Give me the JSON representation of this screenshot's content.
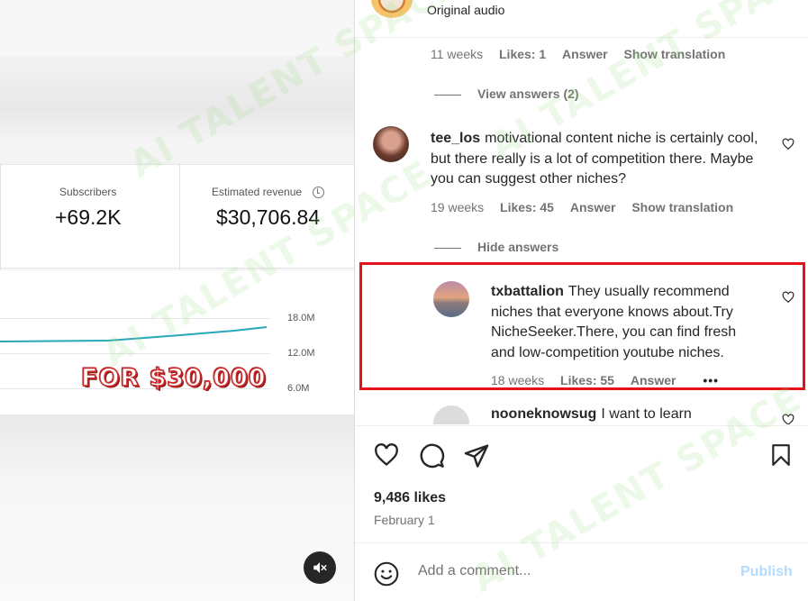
{
  "media": {
    "stats": [
      {
        "label": "Subscribers",
        "value": "+69.2K"
      },
      {
        "label": "Estimated revenue",
        "value": "$30,706.84"
      }
    ],
    "axis_ticks": [
      "18.0M",
      "12.0M",
      "6.0M"
    ],
    "overlay_text": "FOR $30,000",
    "accent_line_color": "#27a8b8",
    "overlay_color": "#c62828",
    "mute_icon": "speaker-muted-icon"
  },
  "header": {
    "audio_label": "Original audio"
  },
  "comments": {
    "prev_meta": {
      "age": "11 weeks",
      "likes": "Likes: 1",
      "reply": "Answer",
      "translate": "Show translation"
    },
    "view_answers": "View answers (2)",
    "c1": {
      "user": "tee_los",
      "text": "motivational content niche is certainly cool, but there really is a lot of competition there. Maybe you can suggest other niches?",
      "age": "19 weeks",
      "likes": "Likes: 45",
      "reply": "Answer",
      "translate": "Show translation"
    },
    "hide_answers": "Hide answers",
    "reply1": {
      "user": "txbattalion",
      "text": "They usually recommend niches that everyone knows about.Try NicheSeeker.There, you can find fresh and low-competition youtube niches.",
      "age": "18 weeks",
      "likes": "Likes: 55",
      "reply": "Answer",
      "more": "•••"
    },
    "c2": {
      "user": "nooneknowsug",
      "text": "I want to learn"
    },
    "highlight_color": "#e3121b"
  },
  "actions": {
    "icons": [
      "heart-icon",
      "comment-icon",
      "share-icon",
      "bookmark-icon"
    ]
  },
  "post": {
    "likes": "9,486 likes",
    "date": "February 1"
  },
  "composer": {
    "emoji_icon": "emoji-icon",
    "placeholder": "Add a comment...",
    "publish": "Publish",
    "publish_color": "#b3dbff"
  },
  "watermark": "AI TALENT SPACE"
}
